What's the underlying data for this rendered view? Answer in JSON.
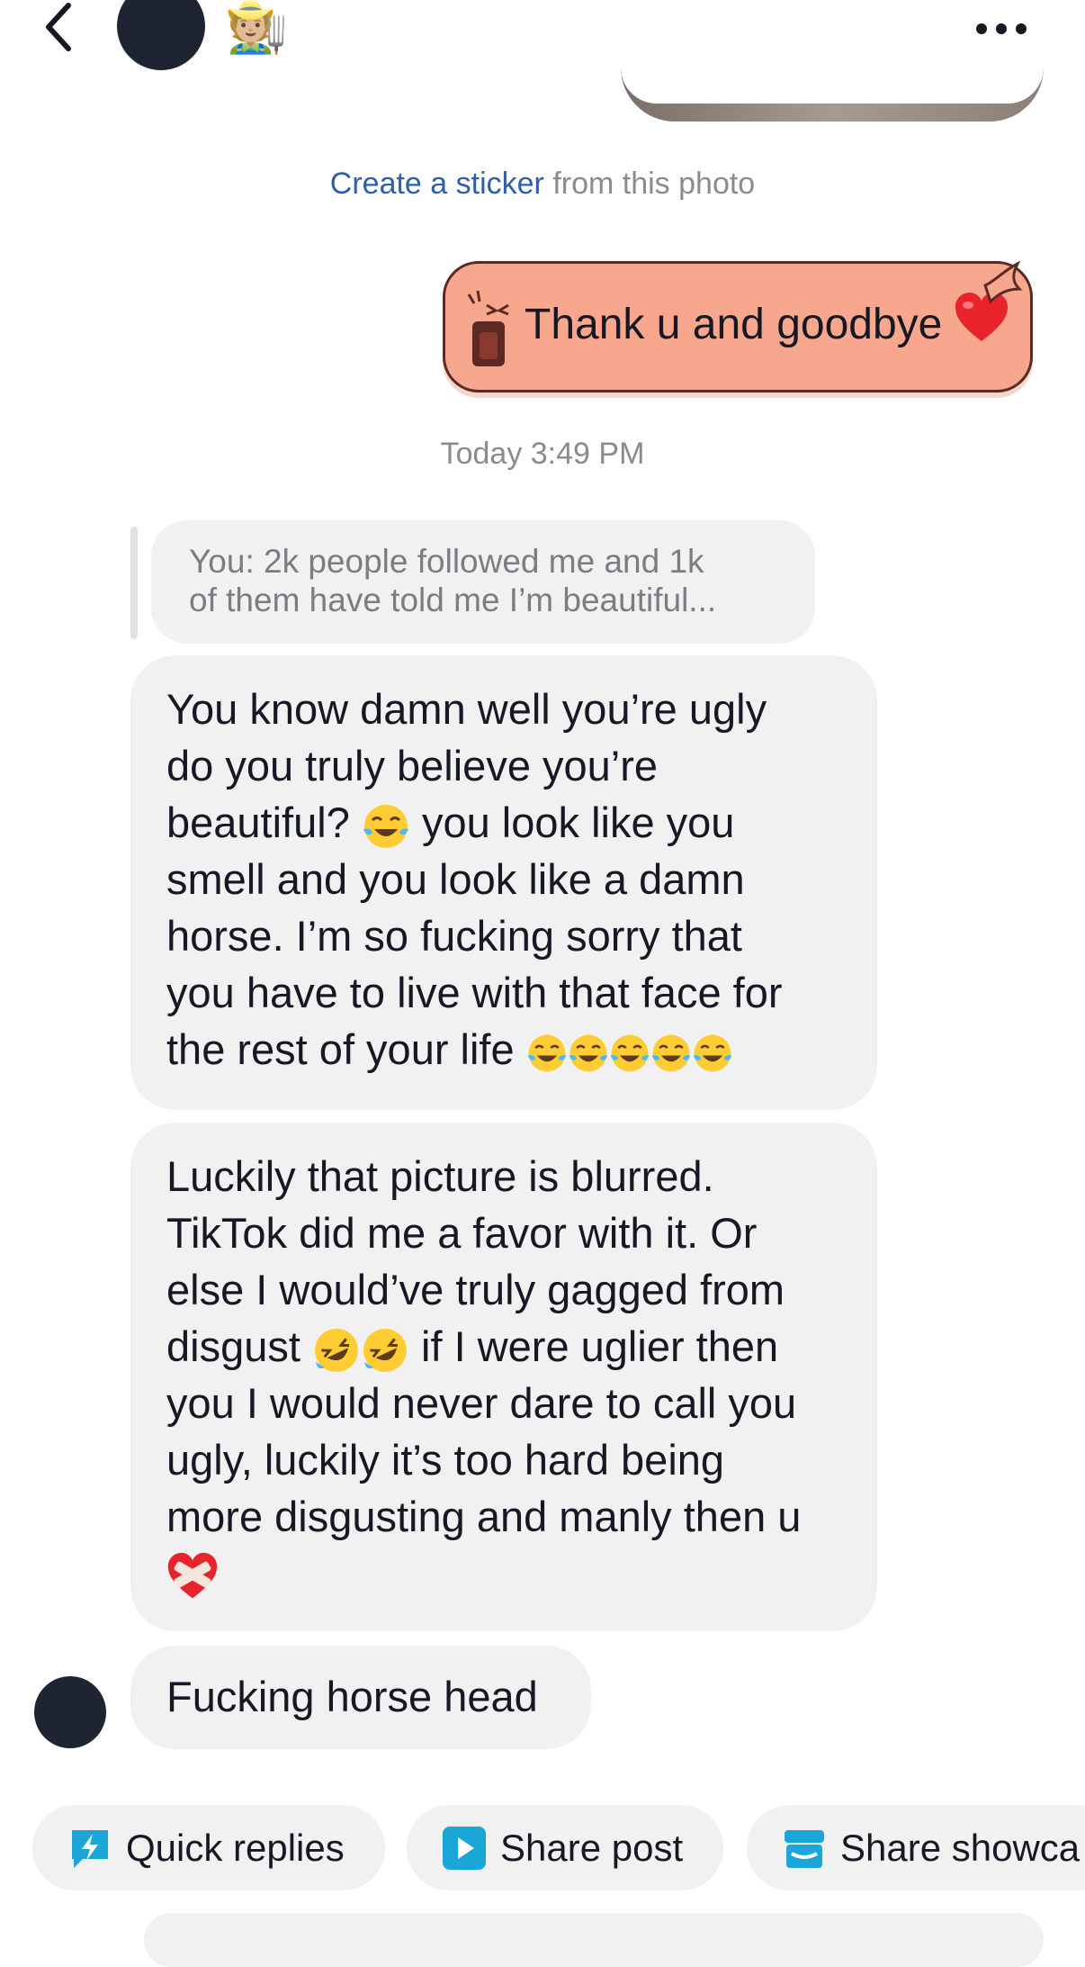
{
  "header": {
    "emoji": "🧑🏼‍🌾"
  },
  "sticker_prompt": {
    "link": "Create a sticker",
    "rest": " from this photo"
  },
  "sent_message": {
    "text": "Thank u and goodbye"
  },
  "timestamp": "Today 3:49 PM",
  "quoted_reply": {
    "line1": "You: 2k people followed me and 1k",
    "line2": "of them have told me I’m beautiful..."
  },
  "messages": [
    {
      "lines": [
        "You know damn well you’re ugly",
        "do you truly believe you’re",
        "beautiful?",
        " you look like you",
        "smell and you look like a damn",
        "horse. I’m so fucking sorry that",
        "you have to live with that face for",
        "the rest of your life"
      ]
    },
    {
      "lines": [
        "Luckily that picture is blurred.",
        "TikTok did me a favor with it. Or",
        "else I would’ve truly gagged from",
        "disgust",
        " if I were uglier then",
        "you I would never dare to call you",
        "ugly, luckily it’s too hard being",
        "more disgusting and manly then u"
      ]
    },
    {
      "text": "Fucking horse head"
    }
  ],
  "quick_actions": [
    {
      "label": "Quick replies",
      "icon": "lightning-chat-icon"
    },
    {
      "label": "Share post",
      "icon": "play-icon"
    },
    {
      "label": "Share showca",
      "icon": "storefront-icon"
    }
  ],
  "colors": {
    "accent_link": "#2f5fa8",
    "sent_bubble": "#f8a78f",
    "received_bubble": "#f1f1f2",
    "chip_icon": "#1aa6d6"
  }
}
